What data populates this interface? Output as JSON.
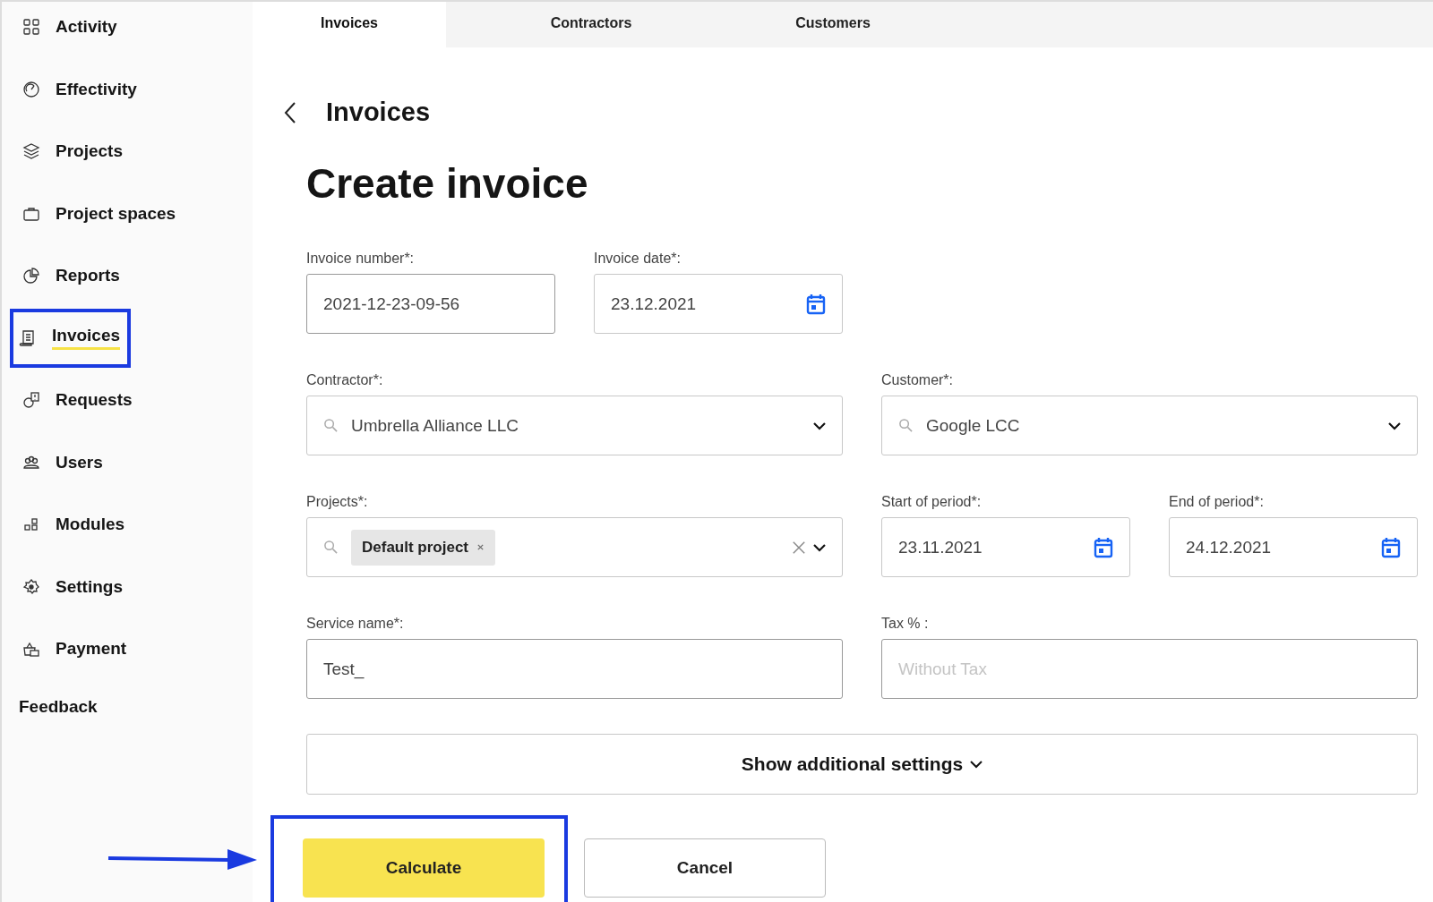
{
  "sidebar": {
    "items": [
      {
        "label": "Activity",
        "selected": false,
        "annotated": false
      },
      {
        "label": "Effectivity",
        "selected": false,
        "annotated": false
      },
      {
        "label": "Projects",
        "selected": false,
        "annotated": false
      },
      {
        "label": "Project spaces",
        "selected": false,
        "annotated": false
      },
      {
        "label": "Reports",
        "selected": false,
        "annotated": false
      },
      {
        "label": "Invoices",
        "selected": true,
        "annotated": true
      },
      {
        "label": "Requests",
        "selected": false,
        "annotated": false
      },
      {
        "label": "Users",
        "selected": false,
        "annotated": false
      },
      {
        "label": "Modules",
        "selected": false,
        "annotated": false
      },
      {
        "label": "Settings",
        "selected": false,
        "annotated": false
      },
      {
        "label": "Payment",
        "selected": false,
        "annotated": false
      }
    ],
    "feedback": "Feedback"
  },
  "tabs": [
    {
      "label": "Invoices",
      "selected": true
    },
    {
      "label": "Contractors",
      "selected": false
    },
    {
      "label": "Customers",
      "selected": false
    }
  ],
  "breadcrumb": "Invoices",
  "title": "Create invoice",
  "fields": [
    {
      "kind": "text",
      "label": "Invoice number*:",
      "value": "2021-12-23-09-56"
    },
    {
      "kind": "date",
      "label": "Invoice date*:",
      "value": "23.12.2021"
    },
    {
      "kind": "select",
      "label": "Contractor*:",
      "value": "Umbrella Alliance LLC"
    },
    {
      "kind": "select",
      "label": "Customer*:",
      "value": "Google LCC"
    },
    {
      "kind": "tags",
      "label": "Projects*:",
      "tags": [
        "Default project"
      ]
    },
    {
      "kind": "date",
      "label": "Start of period*:",
      "value": "23.11.2021"
    },
    {
      "kind": "date",
      "label": "End of period*:",
      "value": "24.12.2021"
    },
    {
      "kind": "text",
      "label": "Service name*:",
      "value": "Test_"
    },
    {
      "kind": "text",
      "label": "Tax % :",
      "placeholder": "Without Tax"
    }
  ],
  "additional_settings": "Show additional settings",
  "buttons": [
    {
      "label": "Calculate",
      "kind": "primary",
      "annotated": true
    },
    {
      "label": "Cancel",
      "kind": "secondary",
      "annotated": false
    }
  ]
}
